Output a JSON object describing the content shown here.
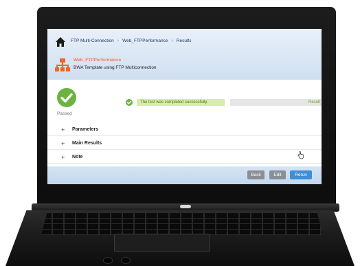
{
  "breadcrumb": {
    "items": [
      "FTP Multi-Connection",
      "Web_FTPPerformance",
      "Results"
    ]
  },
  "template": {
    "title": "Web_FTPPerformance",
    "subtitle": "BWA Template using FTP Multiconnection"
  },
  "status": {
    "label": "Passed",
    "message": "The test was completed successfully.",
    "result_label": "Result"
  },
  "sections": [
    {
      "label": "Parameters"
    },
    {
      "label": "Main Results"
    },
    {
      "label": "Note"
    }
  ],
  "buttons": {
    "back": "Back",
    "edit": "Edit",
    "rerun": "Rerun"
  },
  "colors": {
    "success_green": "#6cb33f",
    "success_bg": "#d7eda8",
    "accent_blue": "#3f8fd6",
    "template_orange": "#f47b50"
  },
  "icons": {
    "home": "home-icon",
    "template": "network-tree-icon",
    "status": "check-circle-icon",
    "cursor": "hand-pointer-icon"
  }
}
